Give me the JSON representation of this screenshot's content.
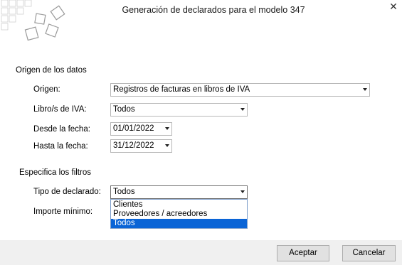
{
  "dialog": {
    "title": "Generación de declarados para el modelo 347",
    "close_glyph": "✕"
  },
  "origen_datos": {
    "heading": "Origen de los datos",
    "origen": {
      "label": "Origen:",
      "value": "Registros de facturas en libros de IVA"
    },
    "libros": {
      "label": "Libro/s de IVA:",
      "value": "Todos"
    },
    "desde": {
      "label": "Desde la fecha:",
      "value": "01/01/2022"
    },
    "hasta": {
      "label": "Hasta la fecha:",
      "value": "31/12/2022"
    }
  },
  "filtros": {
    "heading": "Especifica los filtros",
    "tipo_declarado": {
      "label": "Tipo de declarado:",
      "value": "Todos",
      "options": [
        "Clientes",
        "Proveedores / acreedores",
        "Todos"
      ],
      "selected_index": 2
    },
    "importe_minimo": {
      "label": "Importe mínimo:"
    }
  },
  "buttons": {
    "accept": "Aceptar",
    "cancel": "Cancelar"
  },
  "colors": {
    "selection": "#0a64d6",
    "footer_bg": "#f0f0f0"
  }
}
